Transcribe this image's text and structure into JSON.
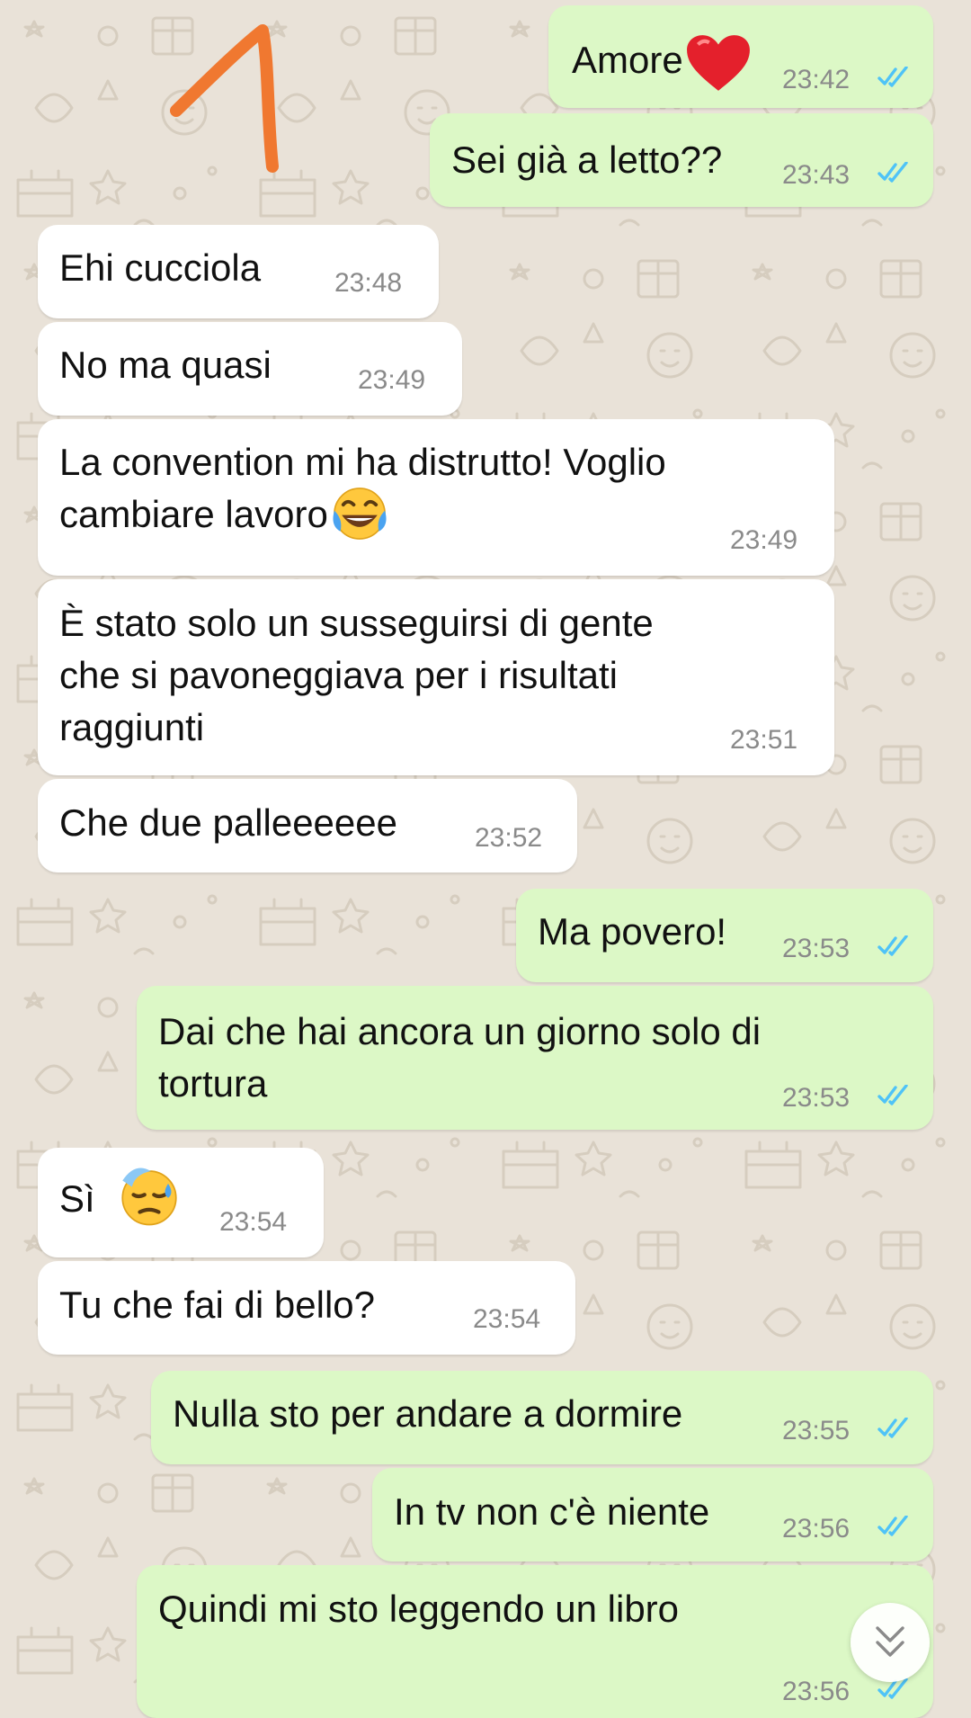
{
  "colors": {
    "incoming_bubble": "#ffffff",
    "outgoing_bubble": "#dcf8c6",
    "wallpaper": "#e9e2d8",
    "read_ticks": "#4fc3f7",
    "annotation": "#f07830"
  },
  "messages": [
    {
      "direction": "out",
      "text": "Amore",
      "emoji": "red-heart-icon",
      "time": "23:42",
      "status": "read"
    },
    {
      "direction": "out",
      "text": "Sei già a letto??",
      "time": "23:43",
      "status": "read"
    },
    {
      "direction": "in",
      "text": "Ehi cucciola",
      "time": "23:48"
    },
    {
      "direction": "in",
      "text": "No ma quasi",
      "time": "23:49"
    },
    {
      "direction": "in",
      "text": "La convention mi ha distrutto! Voglio\ncambiare lavoro",
      "emoji": "face-with-tears-of-joy-icon",
      "time": "23:49"
    },
    {
      "direction": "in",
      "text": "È stato solo un susseguirsi di gente\nche si pavoneggiava per i risultati\nraggiunti",
      "time": "23:51"
    },
    {
      "direction": "in",
      "text": "Che due palleeeeee",
      "time": "23:52"
    },
    {
      "direction": "out",
      "text": "Ma povero!",
      "time": "23:53",
      "status": "read"
    },
    {
      "direction": "out",
      "text": "Dai che hai ancora un giorno solo di\ntortura",
      "time": "23:53",
      "status": "read"
    },
    {
      "direction": "in",
      "text": "Sì",
      "emoji": "downcast-face-with-sweat-icon",
      "time": "23:54"
    },
    {
      "direction": "in",
      "text": "Tu che fai di bello?",
      "time": "23:54"
    },
    {
      "direction": "out",
      "text": "Nulla sto per andare a dormire",
      "time": "23:55",
      "status": "read"
    },
    {
      "direction": "out",
      "text": "In tv non c'è niente",
      "time": "23:56",
      "status": "read"
    },
    {
      "direction": "out",
      "text": "Quindi mi sto leggendo un libro",
      "time": "23:56",
      "status": "read"
    }
  ],
  "scroll_button": {
    "icon": "double-chevron-down-icon"
  },
  "annotation": {
    "icon": "hand-drawn-arrow-icon"
  }
}
